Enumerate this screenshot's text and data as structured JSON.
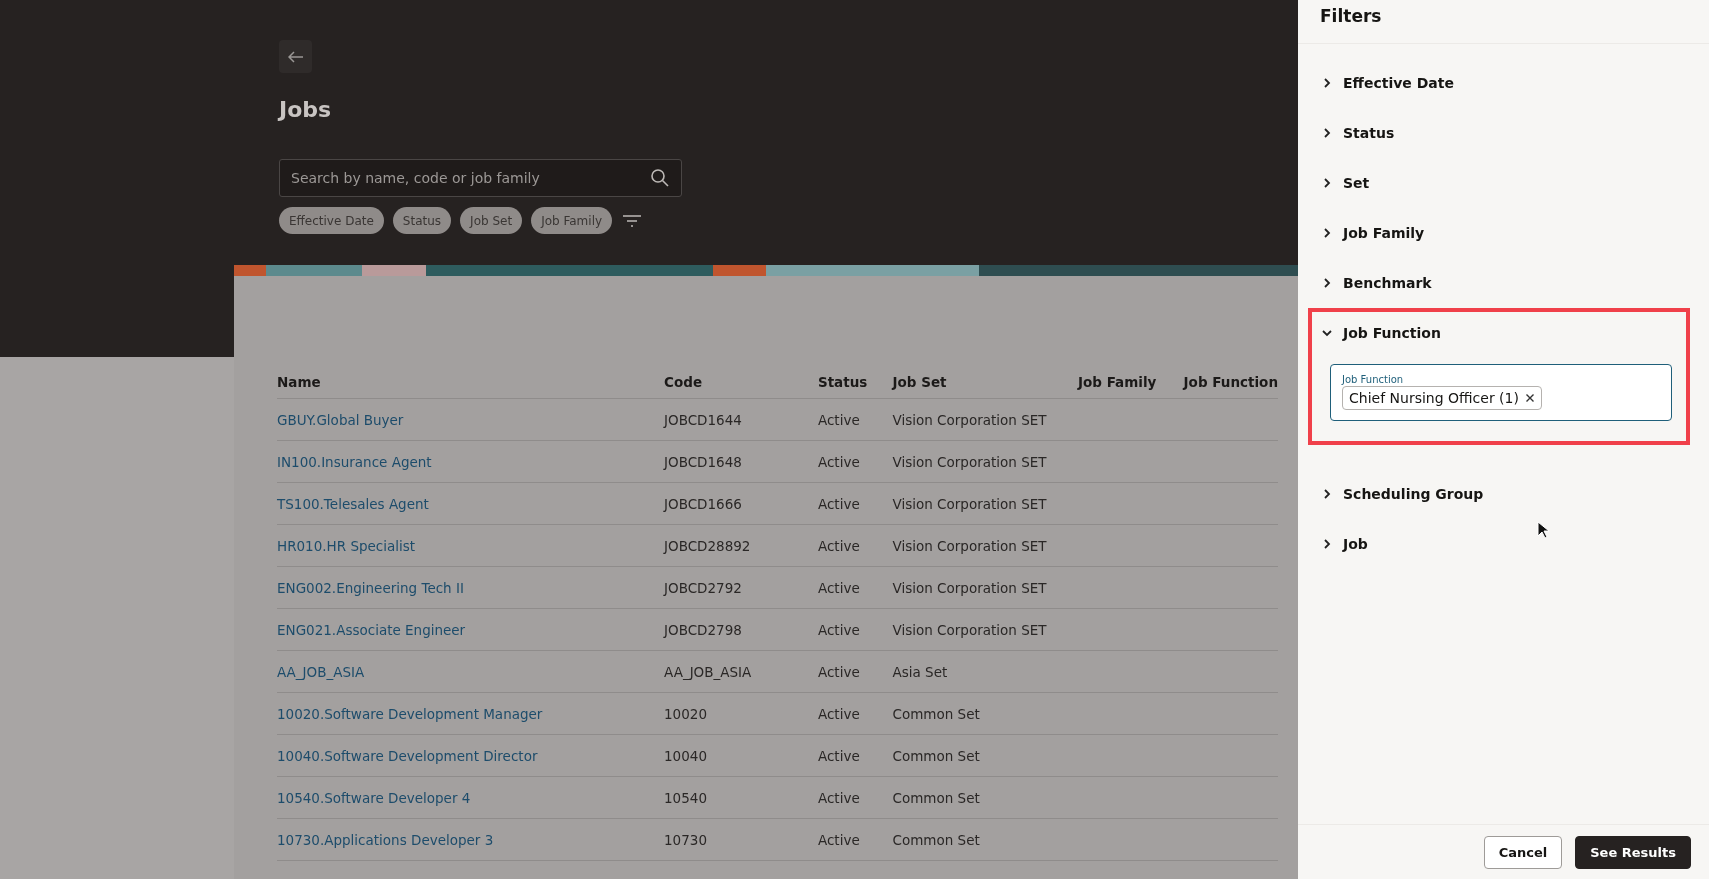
{
  "page": {
    "title": "Jobs",
    "search": {
      "placeholder": "Search by name, code or job family"
    },
    "filter_chips": [
      "Effective Date",
      "Status",
      "Job Set",
      "Job Family"
    ]
  },
  "table": {
    "columns": [
      "Name",
      "Code",
      "Status",
      "Job Set",
      "Job Family",
      "Job Function"
    ],
    "rows": [
      {
        "name": "GBUY.Global Buyer",
        "code": "JOBCD1644",
        "status": "Active",
        "job_set": "Vision Corporation SET"
      },
      {
        "name": "IN100.Insurance Agent",
        "code": "JOBCD1648",
        "status": "Active",
        "job_set": "Vision Corporation SET"
      },
      {
        "name": "TS100.Telesales Agent",
        "code": "JOBCD1666",
        "status": "Active",
        "job_set": "Vision Corporation SET"
      },
      {
        "name": "HR010.HR Specialist",
        "code": "JOBCD28892",
        "status": "Active",
        "job_set": "Vision Corporation SET"
      },
      {
        "name": "ENG002.Engineering Tech II",
        "code": "JOBCD2792",
        "status": "Active",
        "job_set": "Vision Corporation SET"
      },
      {
        "name": "ENG021.Associate Engineer",
        "code": "JOBCD2798",
        "status": "Active",
        "job_set": "Vision Corporation SET"
      },
      {
        "name": "AA_JOB_ASIA",
        "code": "AA_JOB_ASIA",
        "status": "Active",
        "job_set": "Asia Set"
      },
      {
        "name": "10020.Software Development Manager",
        "code": "10020",
        "status": "Active",
        "job_set": "Common Set"
      },
      {
        "name": "10040.Software Development Director",
        "code": "10040",
        "status": "Active",
        "job_set": "Common Set"
      },
      {
        "name": "10540.Software Developer 4",
        "code": "10540",
        "status": "Active",
        "job_set": "Common Set"
      },
      {
        "name": "10730.Applications Developer 3",
        "code": "10730",
        "status": "Active",
        "job_set": "Common Set"
      }
    ]
  },
  "filters_panel": {
    "title": "Filters",
    "sections": [
      {
        "label": "Effective Date",
        "expanded": false,
        "highlighted": false
      },
      {
        "label": "Status",
        "expanded": false,
        "highlighted": false
      },
      {
        "label": "Set",
        "expanded": false,
        "highlighted": false
      },
      {
        "label": "Job Family",
        "expanded": false,
        "highlighted": false
      },
      {
        "label": "Benchmark",
        "expanded": false,
        "highlighted": false
      },
      {
        "label": "Job Function",
        "expanded": true,
        "highlighted": true,
        "field": {
          "label": "Job Function",
          "tags": [
            "Chief Nursing Officer (1)"
          ]
        }
      },
      {
        "label": "Scheduling Group",
        "expanded": false,
        "highlighted": false
      },
      {
        "label": "Job",
        "expanded": false,
        "highlighted": false
      }
    ],
    "buttons": [
      {
        "label": "Cancel",
        "kind": "secondary"
      },
      {
        "label": "See Results",
        "kind": "primary"
      }
    ]
  }
}
